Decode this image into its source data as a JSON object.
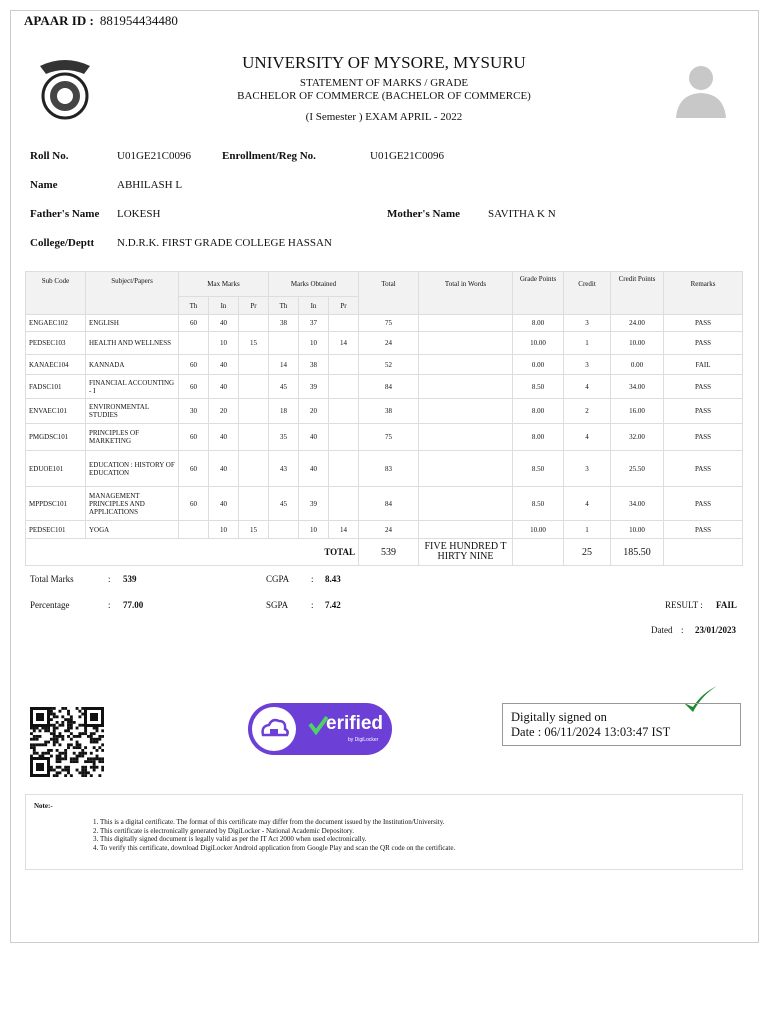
{
  "header": {
    "apaar_label": "APAAR ID :",
    "apaar_id": "881954434480",
    "university": "UNIVERSITY OF MYSORE, MYSURU",
    "statement": "STATEMENT OF MARKS / GRADE",
    "program": "BACHELOR OF COMMERCE (BACHELOR OF COMMERCE)",
    "exam": "(I Semester ) EXAM APRIL - 2022"
  },
  "student": {
    "roll_label": "Roll No.",
    "roll": "U01GE21C0096",
    "enroll_label": "Enrollment/Reg No.",
    "enroll": "U01GE21C0096",
    "name_label": "Name",
    "name": "ABHILASH L",
    "father_label": "Father's Name",
    "father": "LOKESH",
    "mother_label": "Mother's Name",
    "mother": "SAVITHA K N",
    "college_label": "College/Deptt",
    "college": "N.D.R.K. FIRST GRADE COLLEGE HASSAN"
  },
  "table": {
    "headers": [
      "Sub Code",
      "Subject/Papers",
      "Max Marks",
      "Marks Obtained",
      "Total",
      "Total in Words",
      "Grade Points",
      "Credit",
      "Credit Points",
      "Remarks"
    ],
    "sub_headers": [
      "Th",
      "In",
      "Pr",
      "Th",
      "In",
      "Pr"
    ],
    "rows": [
      {
        "code": "ENGAEC102",
        "subject": "ENGLISH",
        "mth": "60",
        "min": "40",
        "mpr": "",
        "oth": "38",
        "oin": "37",
        "opr": "",
        "total": "75",
        "gp": "8.00",
        "credit": "3",
        "cp": "24.00",
        "remarks": "PASS"
      },
      {
        "code": "PEDSEC103",
        "subject": "HEALTH AND WELLNESS",
        "mth": "",
        "min": "10",
        "mpr": "15",
        "oth": "",
        "oin": "10",
        "opr": "14",
        "total": "24",
        "gp": "10.00",
        "credit": "1",
        "cp": "10.00",
        "remarks": "PASS"
      },
      {
        "code": "KANAEC104",
        "subject": "KANNADA",
        "mth": "60",
        "min": "40",
        "mpr": "",
        "oth": "14",
        "oin": "38",
        "opr": "",
        "total": "52",
        "gp": "0.00",
        "credit": "3",
        "cp": "0.00",
        "remarks": "FAIL"
      },
      {
        "code": "FADSC101",
        "subject": "FINANCIAL ACCOUNTING - I",
        "mth": "60",
        "min": "40",
        "mpr": "",
        "oth": "45",
        "oin": "39",
        "opr": "",
        "total": "84",
        "gp": "8.50",
        "credit": "4",
        "cp": "34.00",
        "remarks": "PASS"
      },
      {
        "code": "ENVAEC101",
        "subject": "ENVIRONMENTAL STUDIES",
        "mth": "30",
        "min": "20",
        "mpr": "",
        "oth": "18",
        "oin": "20",
        "opr": "",
        "total": "38",
        "gp": "8.00",
        "credit": "2",
        "cp": "16.00",
        "remarks": "PASS"
      },
      {
        "code": "PMGDSC101",
        "subject": "PRINCIPLES OF MARKETING",
        "mth": "60",
        "min": "40",
        "mpr": "",
        "oth": "35",
        "oin": "40",
        "opr": "",
        "total": "75",
        "gp": "8.00",
        "credit": "4",
        "cp": "32.00",
        "remarks": "PASS"
      },
      {
        "code": "EDUOE101",
        "subject": "EDUCATION : HISTORY OF EDUCATION",
        "mth": "60",
        "min": "40",
        "mpr": "",
        "oth": "43",
        "oin": "40",
        "opr": "",
        "total": "83",
        "gp": "8.50",
        "credit": "3",
        "cp": "25.50",
        "remarks": "PASS"
      },
      {
        "code": "MPPDSC101",
        "subject": "MANAGEMENT PRINCIPLES AND APPLICATIONS",
        "mth": "60",
        "min": "40",
        "mpr": "",
        "oth": "45",
        "oin": "39",
        "opr": "",
        "total": "84",
        "gp": "8.50",
        "credit": "4",
        "cp": "34.00",
        "remarks": "PASS"
      },
      {
        "code": "PEDSEC101",
        "subject": "YOGA",
        "mth": "",
        "min": "10",
        "mpr": "15",
        "oth": "",
        "oin": "10",
        "opr": "14",
        "total": "24",
        "gp": "10.00",
        "credit": "1",
        "cp": "10.00",
        "remarks": "PASS"
      }
    ],
    "total_row": {
      "label": "TOTAL",
      "total": "539",
      "words": "FIVE HUNDRED T HIRTY NINE",
      "credit": "25",
      "cp": "185.50"
    }
  },
  "summary": {
    "total_marks_label": "Total Marks",
    "total_marks": "539",
    "cgpa_label": "CGPA",
    "cgpa": "8.43",
    "percentage_label": "Percentage",
    "percentage": "77.00",
    "sgpa_label": "SGPA",
    "sgpa": "7.42",
    "result_label": "RESULT :",
    "result": "FAIL",
    "dated_label": "Dated",
    "dated": "23/01/2023",
    "colon": ":"
  },
  "verified": {
    "text": "erified",
    "by": "by DigiLocker"
  },
  "signature": {
    "line1": "Digitally signed on",
    "line2": "Date : 06/11/2024 13:03:47 IST"
  },
  "notes": {
    "title": "Note:-",
    "items": [
      "This is a digital certificate. The format of this certificate may differ from the document issued by the Institution/University.",
      "This certificate is electronically generated by DigiLocker - National Academic Depository.",
      "This digitally signed document is legally valid as per the IT Act 2000 when used electronically.",
      "To verify this certificate, download DigiLocker Android application from Google Play and scan the QR code on the certificate."
    ]
  }
}
